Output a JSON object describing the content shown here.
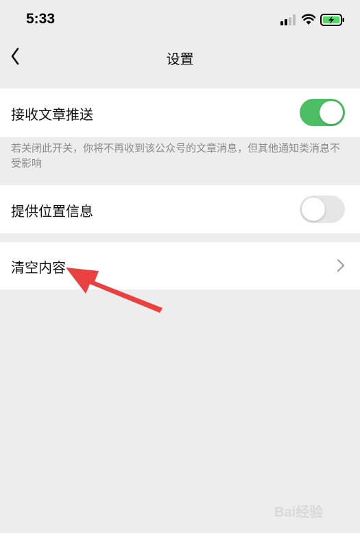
{
  "status_bar": {
    "time": "5:33",
    "icons": [
      "signal-icon",
      "wifi-icon",
      "battery-charging-icon"
    ]
  },
  "nav": {
    "back_icon": "chevron-left-icon",
    "title": "设置"
  },
  "settings": {
    "article_push": {
      "label": "接收文章推送",
      "enabled": true,
      "hint": "若关闭此开关，你将不再收到该公众号的文章消息，但其他通知类消息不受影响"
    },
    "location": {
      "label": "提供位置信息",
      "enabled": false
    },
    "clear_content": {
      "label": "清空内容",
      "icon": "chevron-right-icon"
    }
  },
  "annotation": {
    "type": "red-arrow",
    "color": "#e8413f"
  },
  "watermark": {
    "text": "Bai经验"
  },
  "colors": {
    "background": "#ededed",
    "toggle_on": "#4cbe63",
    "toggle_off": "#e6e6e6",
    "hint_text": "#8a8a8a"
  }
}
